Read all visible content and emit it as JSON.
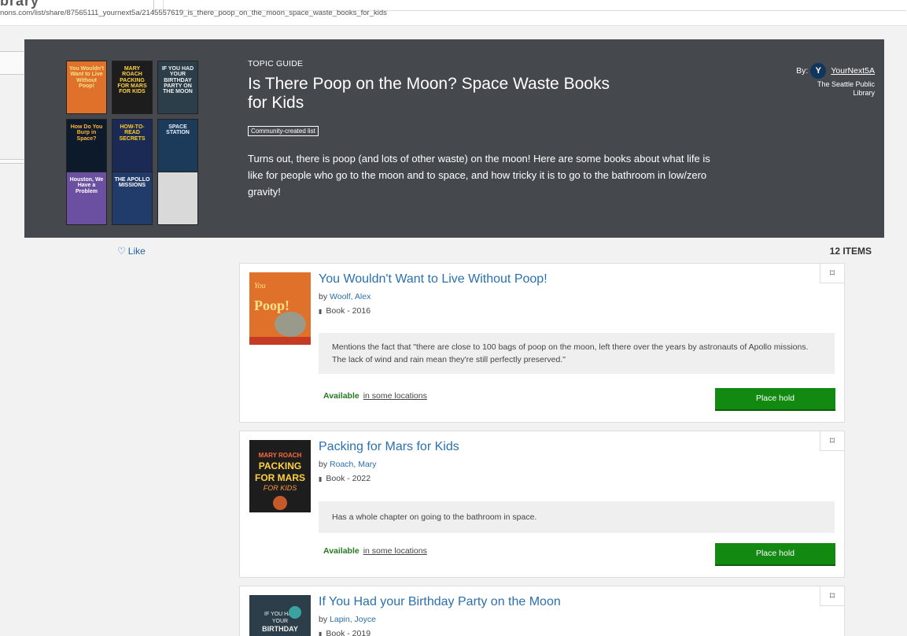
{
  "browser": {
    "ghost_title": "brary",
    "url": "nons.com/list/share/87565111_yournext5a/2145557619_is_there_poop_on_the_moon_space_waste_books_for_kids"
  },
  "hero": {
    "eyebrow": "TOPIC GUIDE",
    "title": "Is There Poop on the Moon? Space Waste Books for Kids",
    "badge": "Community-created list",
    "description": "Turns out, there is poop (and lots of other waste) on the moon! Here are some books about what life is like for people who go to the moon and to space, and how tricky it is to go to the bathroom in low/zero gravity!",
    "by_label": "By:",
    "avatar_letter": "Y",
    "username": "YourNext5A",
    "org_line1": "The Seattle Public",
    "org_line2": "Library",
    "mosaic": [
      {
        "text": "You Wouldn't Want to Live Without Poop!",
        "bg": "#e0712a",
        "fg": "#ffe28a"
      },
      {
        "text": "MARY ROACH PACKING FOR MARS FOR KIDS",
        "bg": "#1d1d1d",
        "fg": "#ffd23f"
      },
      {
        "text": "IF YOU HAD YOUR BIRTHDAY PARTY ON THE MOON",
        "bg": "#2c3e4a",
        "fg": "#f0f0f0"
      },
      {
        "text": "How Do You Burp in Space?",
        "bg": "#0d1a2c",
        "fg": "#ffb23a"
      },
      {
        "text": "HOW-TO-READ SECRETS",
        "bg": "#1a2a55",
        "fg": "#ffcc22"
      },
      {
        "text": "SPACE STATION",
        "bg": "#1c3a5a",
        "fg": "#e8f2ff"
      },
      {
        "text": "Houston, We Have a Problem",
        "bg": "#6b4fa0",
        "fg": "#ffffff"
      },
      {
        "text": "THE APOLLO MISSIONS",
        "bg": "#213c6b",
        "fg": "#ffffff"
      },
      {
        "text": "",
        "bg": "#d9d9d9",
        "fg": "#d9d9d9"
      }
    ]
  },
  "toolbar": {
    "like_icon": "heart-outline-icon",
    "like_label": "Like",
    "count_label": "12 ITEMS"
  },
  "items": [
    {
      "title": "You Wouldn't Want to Live Without Poop!",
      "by": "by",
      "author": "Woolf, Alex",
      "format": "Book - 2016",
      "note": "Mentions the fact that \"there are close to 100 bags of poop on the moon, left there over the years by astronauts of Apollo missions. The lack of wind and rain mean they're still perfectly preserved.\"",
      "status": "Available",
      "locations": "in some locations",
      "hold_label": "Place hold",
      "cover_text": "You Wouldn't Want to Live Without Poop!",
      "cover_bg": "#e0712a",
      "cover_fg": "#ffe28a"
    },
    {
      "title": "Packing for Mars for Kids",
      "by": "by",
      "author": "Roach, Mary",
      "format": "Book - 2022",
      "note": "Has a whole chapter on going to the bathroom in space.",
      "status": "Available",
      "locations": "in some locations",
      "hold_label": "Place hold",
      "cover_text": "MARY ROACH PACKING FOR MARS FOR KIDS",
      "cover_bg": "#1d1d1d",
      "cover_fg": "#ffd23f"
    },
    {
      "title": "If You Had your Birthday Party on the Moon",
      "by": "by",
      "author": "Lapin, Joyce",
      "format": "Book - 2019",
      "cover_text": "IF YOU HAD YOUR BIRTHDAY PARTY",
      "cover_bg": "#2c3e4a",
      "cover_fg": "#f0f0f0"
    }
  ]
}
